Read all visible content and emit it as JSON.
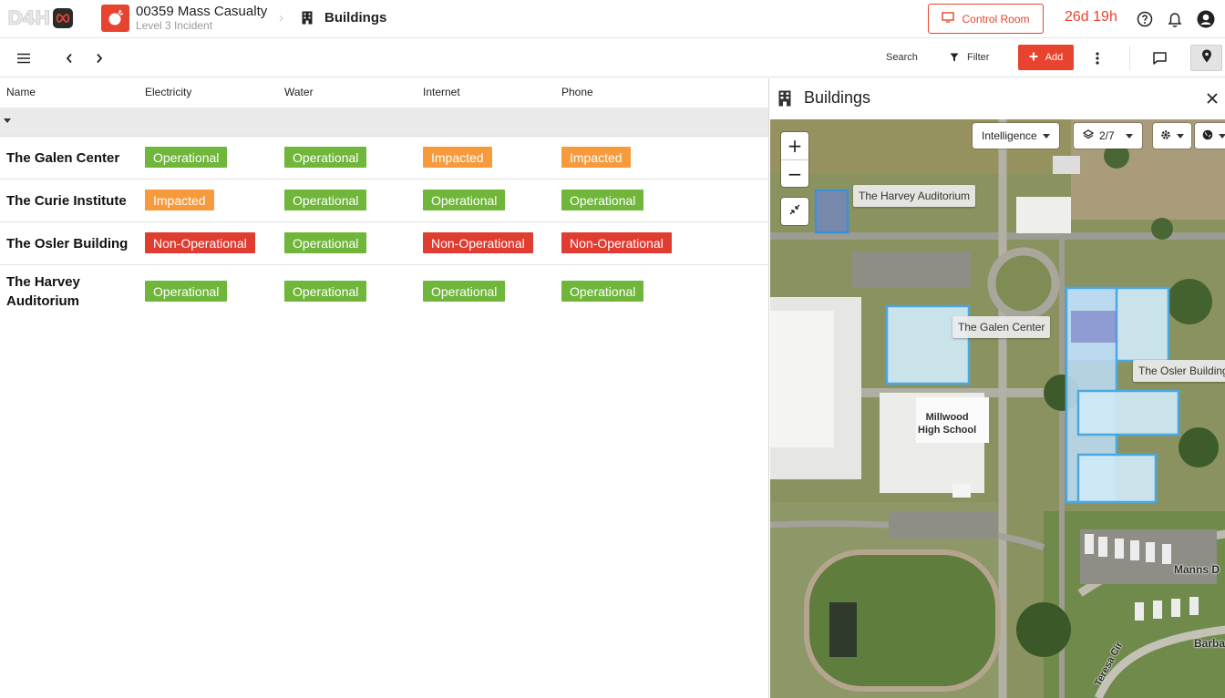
{
  "app": {
    "logo_text_1": "D4H",
    "logo_text_accent": ""
  },
  "header": {
    "incident_title": "00359 Mass Casualty",
    "incident_subtitle": "Level 3 Incident",
    "breadcrumb_separator": "›",
    "page_title": "Buildings",
    "control_room_label": "Control Room",
    "timer": "26d 19h"
  },
  "toolbar": {
    "search_label": "Search",
    "filter_label": "Filter",
    "add_label": "Add"
  },
  "table": {
    "columns": [
      "Name",
      "Electricity",
      "Water",
      "Internet",
      "Phone"
    ],
    "rows": [
      {
        "name": "The Galen Center",
        "electricity": "Operational",
        "water": "Operational",
        "internet": "Impacted",
        "phone": "Impacted"
      },
      {
        "name": "The Curie Institute",
        "electricity": "Impacted",
        "water": "Operational",
        "internet": "Operational",
        "phone": "Operational"
      },
      {
        "name": "The Osler Building",
        "electricity": "Non-Operational",
        "water": "Operational",
        "internet": "Non-Operational",
        "phone": "Non-Operational"
      },
      {
        "name_line1": "The Harvey",
        "name_line2": "Auditorium",
        "electricity": "Operational",
        "water": "Operational",
        "internet": "Operational",
        "phone": "Operational"
      }
    ]
  },
  "status_colors": {
    "Operational": "#6fb63a",
    "Impacted": "#f69a3c",
    "Non-Operational": "#e03c31"
  },
  "panel": {
    "title": "Buildings",
    "layer_select": "Intelligence",
    "layers_count": "2/7",
    "zoom_in": "+",
    "zoom_out": "−"
  },
  "map_labels": {
    "harvey": "The Harvey Auditorium",
    "galen": "The Galen Center",
    "osler": "The Osler Building",
    "school_line1": "Millwood",
    "school_line2": "High School",
    "street_1": "Manns D",
    "street_2": "Barba",
    "street_3": "Teresa Cir"
  },
  "icons": [
    "menu-icon",
    "chevron-left-icon",
    "chevron-right-icon",
    "filter-icon",
    "plus-icon",
    "more-vert-icon",
    "comment-icon",
    "map-pin-icon",
    "help-icon",
    "bell-icon",
    "user-icon",
    "building-icon",
    "close-icon",
    "monitor-icon",
    "layers-icon",
    "gear-icon",
    "globe-icon",
    "fit-icon"
  ]
}
